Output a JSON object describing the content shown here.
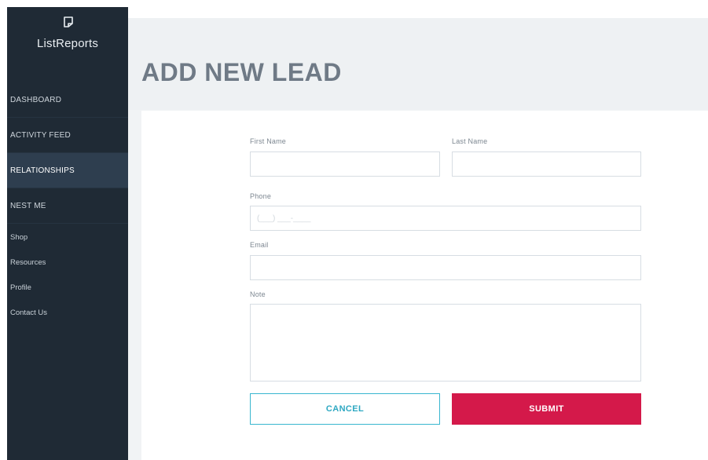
{
  "brand": {
    "name": "ListReports",
    "icon": "listreports-logo-icon"
  },
  "sidebar": {
    "main_items": [
      {
        "label": "DASHBOARD",
        "active": false
      },
      {
        "label": "ACTIVITY FEED",
        "active": false
      },
      {
        "label": "RELATIONSHIPS",
        "active": true
      },
      {
        "label": "NEST ME",
        "active": false
      }
    ],
    "sub_items": [
      {
        "label": "Shop"
      },
      {
        "label": "Resources"
      },
      {
        "label": "Profile"
      },
      {
        "label": "Contact Us"
      }
    ]
  },
  "page": {
    "title": "ADD NEW LEAD"
  },
  "form": {
    "first_name": {
      "label": "First Name",
      "value": "",
      "placeholder": ""
    },
    "last_name": {
      "label": "Last Name",
      "value": "",
      "placeholder": ""
    },
    "phone": {
      "label": "Phone",
      "value": "",
      "placeholder": "(___) ___-____"
    },
    "email": {
      "label": "Email",
      "value": "",
      "placeholder": ""
    },
    "note": {
      "label": "Note",
      "value": "",
      "placeholder": ""
    },
    "cancel_label": "CANCEL",
    "submit_label": "SUBMIT"
  },
  "colors": {
    "sidebar_bg": "#1f2a35",
    "sidebar_active": "#2e3e4f",
    "title": "#6f7a86",
    "cancel_accent": "#38b6cf",
    "submit_bg": "#d4194a"
  }
}
